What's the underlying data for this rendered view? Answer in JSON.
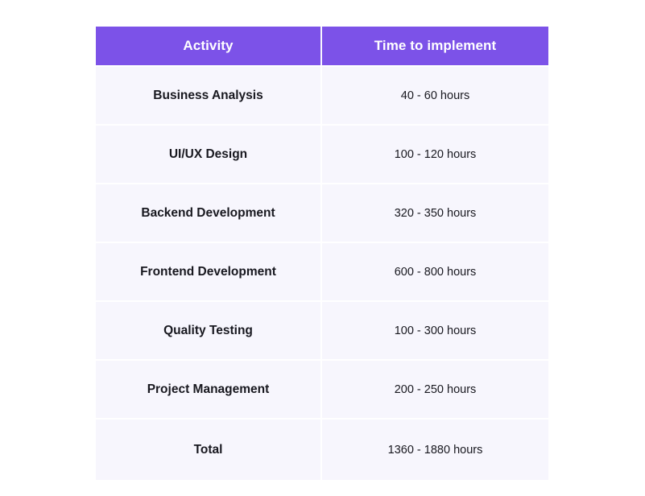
{
  "table": {
    "headers": [
      {
        "label": "Activity",
        "name": "activity"
      },
      {
        "label": "Time to implement",
        "name": "time-to-implement"
      }
    ],
    "rows": [
      {
        "activity": "Business Analysis",
        "time": "40 - 60 hours"
      },
      {
        "activity": "UI/UX Design",
        "time": "100 - 120 hours"
      },
      {
        "activity": "Backend Development",
        "time": "320 - 350 hours"
      },
      {
        "activity": "Frontend Development",
        "time": "600 - 800 hours"
      },
      {
        "activity": "Quality Testing",
        "time": "100 - 300 hours"
      },
      {
        "activity": "Project Management",
        "time": "200 - 250 hours"
      },
      {
        "activity": "Total",
        "time": "1360 - 1880 hours"
      }
    ],
    "colors": {
      "header_background": "#7c52e8",
      "header_text": "#ffffff",
      "cell_background": "#f7f6fd",
      "cell_text": "#18181f",
      "divider": "#ffffff",
      "page_background": "#ffffff"
    }
  }
}
